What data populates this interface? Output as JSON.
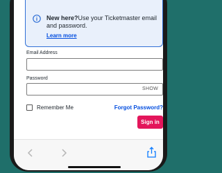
{
  "info": {
    "title": "New here?",
    "body": "Use your Ticketmaster email and password.",
    "link": "Learn more"
  },
  "form": {
    "email_label": "Email Address",
    "email_value": "",
    "password_label": "Password",
    "password_value": "",
    "show_label": "SHOW",
    "remember_label": "Remember Me",
    "forgot_label": "Forgot Password?",
    "signin_label": "Sign in"
  },
  "toolbar": {
    "icons": [
      "back-icon",
      "forward-icon",
      "share-icon"
    ]
  },
  "colors": {
    "background": "#1f6f6a",
    "link": "#024ddf",
    "primary_button": "#e3165b"
  }
}
